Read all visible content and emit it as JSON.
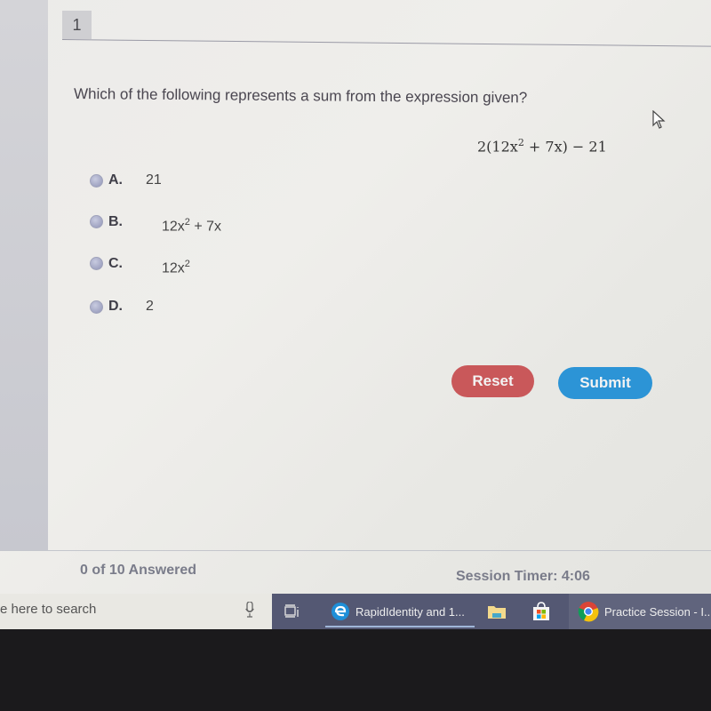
{
  "question": {
    "number": "1",
    "text": "Which of the following represents a sum from the expression given?",
    "expression": {
      "prefix": "2(12x",
      "exp": "2",
      "suffix": " + 7x) − 21"
    }
  },
  "options": [
    {
      "letter": "A.",
      "value": "21",
      "exp": "",
      "tail": ""
    },
    {
      "letter": "B.",
      "value": "12x",
      "exp": "2",
      "tail": " + 7x"
    },
    {
      "letter": "C.",
      "value": "12x",
      "exp": "2",
      "tail": ""
    },
    {
      "letter": "D.",
      "value": "2",
      "exp": "",
      "tail": ""
    }
  ],
  "buttons": {
    "reset": "Reset",
    "submit": "Submit"
  },
  "footer": {
    "answered": "0 of 10 Answered",
    "timer": "Session Timer: 4:06"
  },
  "taskbar": {
    "search_placeholder": "e here to search",
    "edge_label": "RapidIdentity and 1...",
    "chrome_label": "Practice Session - I..."
  },
  "colors": {
    "reset": "#c9585a",
    "submit": "#2c94d6",
    "taskbar": "#545873"
  }
}
